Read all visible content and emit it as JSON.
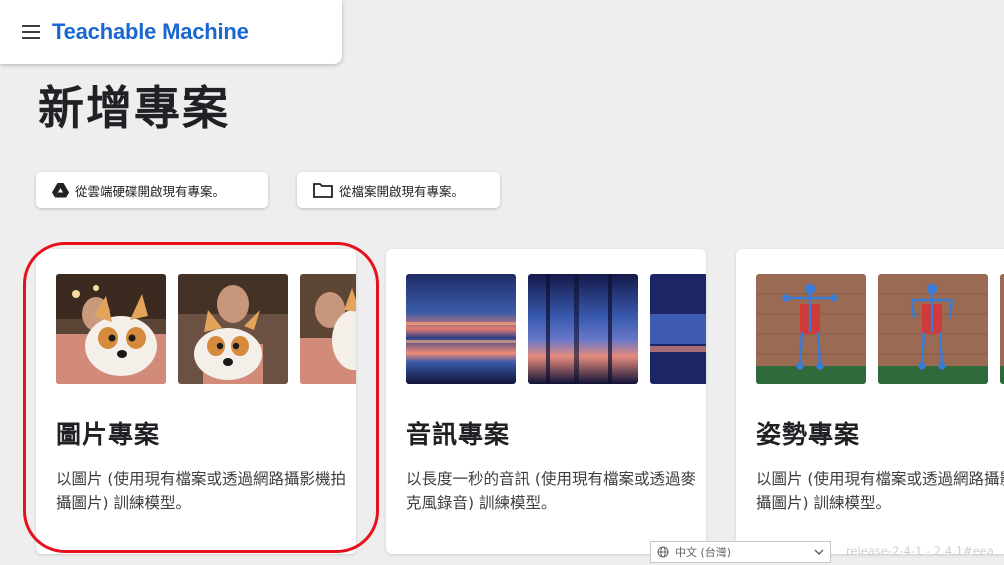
{
  "header": {
    "app_title": "Teachable Machine",
    "menu_icon": "menu-icon"
  },
  "page_title": "新增專案",
  "open_buttons": {
    "drive_label": "從雲端硬碟開啟現有專案。",
    "file_label": "從檔案開啟現有專案。"
  },
  "projects": [
    {
      "title": "圖片專案",
      "description": "以圖片 (使用現有檔案或透過網路攝影機拍攝圖片) 訓練模型。",
      "image_name": "corgi-plush-image"
    },
    {
      "title": "音訊專案",
      "description": "以長度一秒的音訊 (使用現有檔案或透過麥克風錄音) 訓練模型。",
      "image_name": "spectrogram-image"
    },
    {
      "title": "姿勢專案",
      "description": "以圖片 (使用現有檔案或透過網路攝影機拍攝圖片) 訓練模型。",
      "image_name": "pose-skeleton-image"
    }
  ],
  "footer": {
    "language": "中文 (台灣)",
    "release": "release-2-4-1 - 2.4.1#eea"
  },
  "colors": {
    "brand": "#1967d2",
    "highlight": "#e8101d",
    "background": "#eeeeef"
  }
}
